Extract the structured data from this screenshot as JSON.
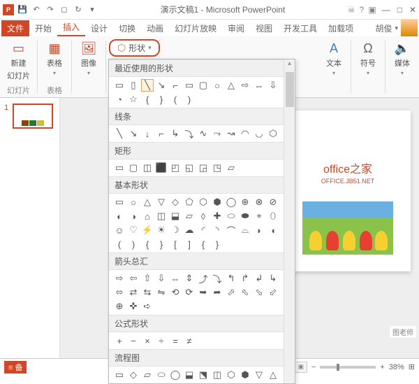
{
  "titlebar": {
    "title": "演示文稿1 - Microsoft PowerPoint"
  },
  "tabs": {
    "file": "文件",
    "home": "开始",
    "insert": "插入",
    "design": "设计",
    "transitions": "切换",
    "animations": "动画",
    "slideshow": "幻灯片放映",
    "review": "审阅",
    "view": "视图",
    "developer": "开发工具",
    "addins": "加载项"
  },
  "user": {
    "name": "胡俊"
  },
  "ribbon": {
    "new_slide": "新建",
    "slide_line2": "幻灯片",
    "group_slides": "幻灯片",
    "tables": "表格",
    "group_tables": "表格",
    "images": "图像",
    "shapes_btn": "形状",
    "text": "文本",
    "symbols": "符号",
    "media": "媒体"
  },
  "shapes_dropdown": {
    "recent": "最近使用的形状",
    "lines": "线条",
    "rects": "矩形",
    "basic": "基本形状",
    "arrows": "箭头总汇",
    "equation": "公式形状",
    "flowchart": "流程图"
  },
  "thumb": {
    "num": "1"
  },
  "slide": {
    "title": "office之家",
    "subtitle": "OFFICE.JB51.NET"
  },
  "statusbar": {
    "notes": "备",
    "zoom": "38%"
  },
  "watermark": "图老师"
}
